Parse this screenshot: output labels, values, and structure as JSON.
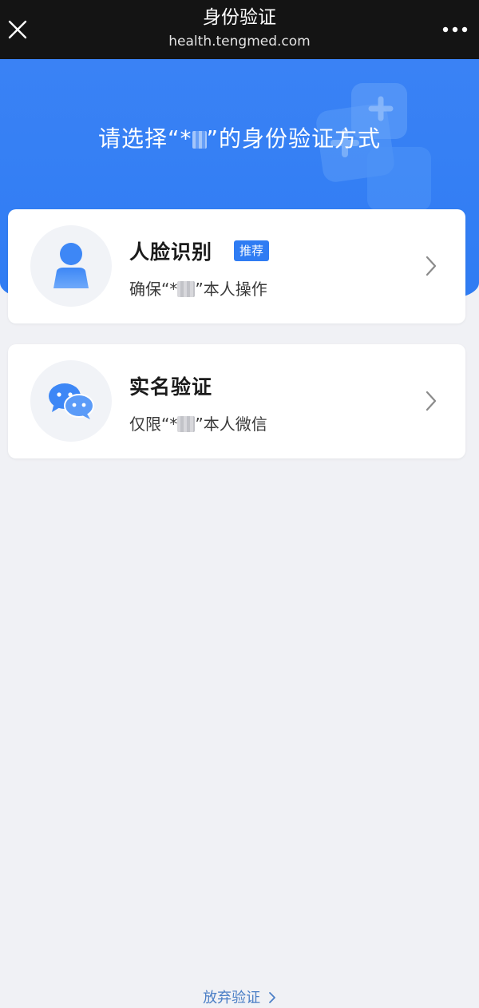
{
  "topbar": {
    "title": "身份验证",
    "url": "health.tengmed.com",
    "close_icon": "close-icon",
    "more_icon": "more-icon"
  },
  "hero": {
    "prompt_prefix": "请选择“*",
    "prompt_suffix": "”的身份验证方式",
    "background_color": "#3a82f5"
  },
  "options": [
    {
      "title": "人脸识别",
      "badge": "推荐",
      "subtitle_prefix": "确保“*",
      "subtitle_suffix": "”本人操作",
      "icon": "person-icon"
    },
    {
      "title": "实名验证",
      "subtitle_prefix": "仅限“*",
      "subtitle_suffix": "”本人微信",
      "icon": "wechat-icon"
    }
  ],
  "footer": {
    "giveup_label": "放弃验证",
    "link_color": "#4c7fc6"
  },
  "colors": {
    "accent": "#2f7cf3",
    "page_bg": "#f0f1f5"
  }
}
